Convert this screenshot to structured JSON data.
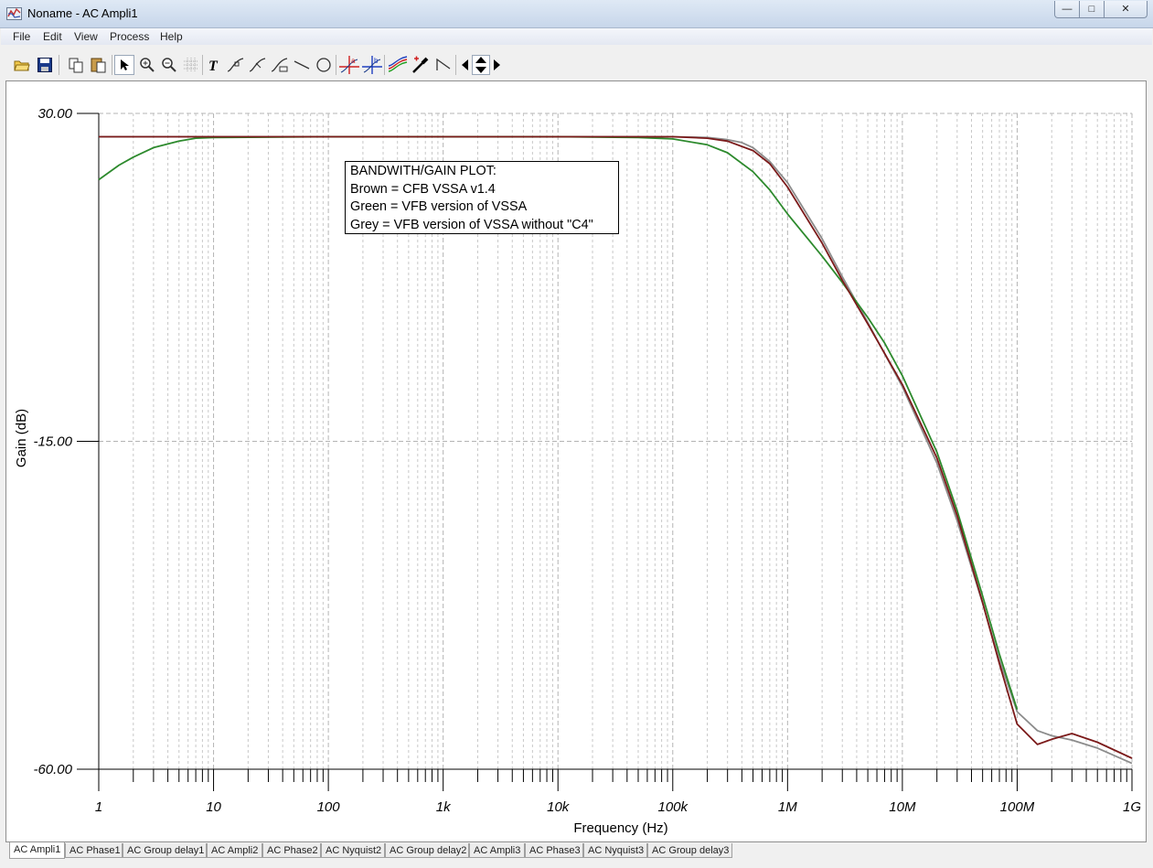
{
  "window": {
    "title": "Noname - AC Ampli1",
    "controls": [
      "minimize",
      "maximize",
      "close"
    ]
  },
  "menu": [
    "File",
    "Edit",
    "View",
    "Process",
    "Help"
  ],
  "toolbar": [
    "open-icon",
    "save-icon",
    "copy-icon",
    "paste-icon",
    "pointer-icon",
    "zoom-in-icon",
    "zoom-out-icon",
    "grid-icon",
    "text-icon",
    "cursor-a-icon",
    "cursor-b-icon",
    "marker-icon",
    "line-icon",
    "circle-icon",
    "cursor-place-a-icon",
    "cursor-place-b-icon",
    "curves-icon",
    "probe-icon",
    "step-icon",
    "arrow-left-icon",
    "arrow-updown-icon",
    "arrow-right-icon"
  ],
  "legend": {
    "title": "BANDWITH/GAIN PLOT:",
    "lines": [
      "Brown = CFB VSSA v1.4",
      "Green = VFB version of VSSA",
      "Grey = VFB version of VSSA without \"C4\""
    ]
  },
  "tabs": [
    "AC Ampli1",
    "AC Phase1",
    "AC Group delay1",
    "AC Ampli2",
    "AC Phase2",
    "AC Nyquist2",
    "AC Group delay2",
    "AC Ampli3",
    "AC Phase3",
    "AC Nyquist3",
    "AC Group delay3"
  ],
  "active_tab": "AC Ampli1",
  "chart_data": {
    "type": "line",
    "xlabel": "Frequency (Hz)",
    "ylabel": "Gain (dB)",
    "x_scale": "log",
    "xlim": [
      1,
      1000000000
    ],
    "ylim": [
      -60,
      30
    ],
    "x_ticks": [
      1,
      10,
      100,
      1000,
      10000,
      100000,
      1000000,
      10000000,
      100000000,
      1000000000
    ],
    "x_tick_labels": [
      "1",
      "10",
      "100",
      "1k",
      "10k",
      "100k",
      "1M",
      "10M",
      "100M",
      "1G"
    ],
    "y_ticks": [
      30,
      -15,
      -60
    ],
    "y_tick_labels": [
      "30.00",
      "-15.00",
      "-60.00"
    ],
    "grid": true,
    "series": [
      {
        "color": "#7b1a1a",
        "x": [
          1,
          10,
          100,
          1000,
          10000,
          100000,
          200000,
          300000,
          500000,
          700000,
          1000000,
          2000000,
          3000000,
          5000000,
          10000000,
          20000000,
          30000000,
          50000000,
          70000000,
          100000000,
          150000000,
          200000000,
          300000000,
          500000000,
          1000000000
        ],
        "y": [
          26.8,
          26.8,
          26.8,
          26.8,
          26.8,
          26.8,
          26.6,
          26.2,
          24.9,
          23.1,
          19.9,
          12.2,
          7.1,
          1.1,
          -7.2,
          -17.3,
          -25.2,
          -37.1,
          -45.5,
          -53.8,
          -56.6,
          -55.9,
          -55.1,
          -56.3,
          -58.5
        ]
      },
      {
        "color": "#2d8a2d",
        "x": [
          1,
          1.5,
          2,
          3,
          5,
          7,
          10,
          100,
          1000,
          10000,
          50000,
          100000,
          200000,
          300000,
          500000,
          700000,
          1000000,
          2000000,
          3000000,
          5000000,
          7000000,
          10000000,
          20000000,
          30000000,
          50000000,
          70000000,
          100000000
        ],
        "y": [
          20.9,
          22.9,
          24.0,
          25.3,
          26.2,
          26.6,
          26.7,
          26.8,
          26.8,
          26.8,
          26.7,
          26.5,
          25.7,
          24.6,
          22.0,
          19.5,
          16.2,
          10.4,
          6.8,
          2.0,
          -1.5,
          -6.0,
          -16.5,
          -24.5,
          -36.2,
          -44.2,
          -51.8
        ]
      },
      {
        "color": "#8c8c8c",
        "x": [
          1,
          10,
          100,
          1000,
          10000,
          100000,
          200000,
          300000,
          400000,
          500000,
          700000,
          1000000,
          2000000,
          3000000,
          5000000,
          10000000,
          20000000,
          30000000,
          50000000,
          70000000,
          100000000,
          150000000,
          200000000,
          300000000,
          500000000,
          1000000000
        ],
        "y": [
          26.8,
          26.8,
          26.8,
          26.8,
          26.8,
          26.8,
          26.7,
          26.4,
          26.0,
          25.3,
          23.4,
          20.5,
          12.8,
          7.6,
          1.3,
          -7.5,
          -18.0,
          -25.9,
          -37.2,
          -45.0,
          -52.1,
          -54.7,
          -55.4,
          -56.0,
          -57.1,
          -59.2
        ]
      }
    ]
  }
}
